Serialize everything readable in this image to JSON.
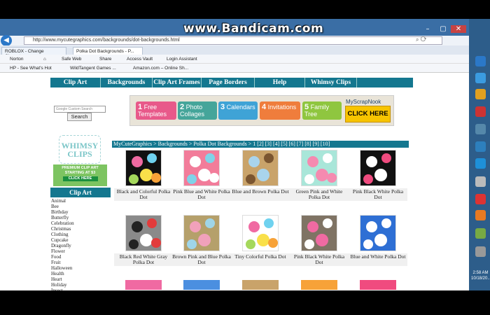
{
  "recorder": {
    "watermark": "www.Bandicam.com",
    "hp": "hp"
  },
  "browser": {
    "url": "http://www.mycutegraphics.com/backgrounds/dot-backgrounds.html",
    "tabs": [
      "ROBLOX - Change Character",
      "Polka Dot Backgrounds - P..."
    ],
    "toolbar1": [
      "Norton",
      "Safe Web",
      "Share",
      "Access Vault",
      "Login Assistant"
    ],
    "toolbar2": [
      "HP - See What's Hot",
      "WildTangent Games ...",
      "Amazon.com – Online Sh..."
    ]
  },
  "site": {
    "nav": [
      "Clip Art",
      "Backgrounds",
      "Clip Art Frames",
      "Page Borders",
      "Help",
      "Whimsy Clips"
    ],
    "search_placeholder": "Google Custom Search",
    "search_button": "Search",
    "banner": {
      "items": [
        {
          "num": "1",
          "text": "Free Templates",
          "color": "#e8598a"
        },
        {
          "num": "2",
          "text": "Photo Collages",
          "color": "#45a59a"
        },
        {
          "num": "3",
          "text": "Calendars",
          "color": "#3fa3d6"
        },
        {
          "num": "4",
          "text": "Invitations",
          "color": "#ef7d3c"
        },
        {
          "num": "5",
          "text": "Family Tree",
          "color": "#8fc63f"
        }
      ],
      "ad_title": "MyScrapNook",
      "ad_button": "CLICK HERE"
    },
    "whimsy": {
      "logo": "WHIMSY CLIPS",
      "premium": "PREMIUM CLIP ART STARTING AT $3",
      "premium_button": "CLICK HERE"
    },
    "sidebar": {
      "heading": "Clip Art",
      "links": [
        "Animal",
        "Bee",
        "Birthday",
        "Butterfly",
        "Celebration",
        "Christmas",
        "Clothing",
        "Cupcake",
        "Dragonfly",
        "Flower",
        "Food",
        "Fruit",
        "Halloween",
        "Health",
        "Heart",
        "Holiday",
        "Insect"
      ]
    },
    "breadcrumb": "MyCuteGraphics > Backgrounds > Polka Dot Backgrounds > 1 [2] [3] [4] [5] [6] [7] [8] [9] [10]",
    "thumbnails": [
      {
        "caption": "Black and Colorful Polka Dot",
        "bg": "#111111",
        "dots": [
          "#f06aa2",
          "#6fd2ef",
          "#f9e04a",
          "#a5d85c",
          "#f7a238"
        ]
      },
      {
        "caption": "Pink Blue and White Polka Dot",
        "bg": "#f27c9a",
        "dots": [
          "#ffffff",
          "#7fd3e8",
          "#ffffff",
          "#7fd3e8",
          "#ffffff"
        ]
      },
      {
        "caption": "Blue and Brown Polka Dot",
        "bg": "#c9a36a",
        "dots": [
          "#a9d4ec",
          "#7a5530",
          "#a9d4ec",
          "#7a5530"
        ]
      },
      {
        "caption": "Green Pink and White Polka Dot",
        "bg": "#a9e6d9",
        "dots": [
          "#f58ab0",
          "#ffffff",
          "#f58ab0",
          "#ffffff",
          "#f58ab0"
        ]
      },
      {
        "caption": "Pink Black White Polka Dot",
        "bg": "#111111",
        "dots": [
          "#ffffff",
          "#f04b7f",
          "#ffffff",
          "#f04b7f"
        ]
      },
      {
        "caption": "Black Red White Gray Polka Dot",
        "bg": "#8a8a8a",
        "dots": [
          "#222222",
          "#e23b3b",
          "#ffffff",
          "#222222",
          "#e23b3b"
        ]
      },
      {
        "caption": "Brown Pink and Blue Polka Dot",
        "bg": "#b5a06b",
        "dots": [
          "#f1a1ba",
          "#9fd5e8",
          "#f1a1ba",
          "#9fd5e8"
        ]
      },
      {
        "caption": "Tiny Colorful Polka Dot",
        "bg": "#ffffff",
        "dots": [
          "#f06aa2",
          "#6fd2ef",
          "#f9e04a",
          "#a5d85c",
          "#f7a238"
        ]
      },
      {
        "caption": "Pink Black White Polka Dot",
        "bg": "#7f7364",
        "dots": [
          "#f06aa2",
          "#ffffff",
          "#f06aa2",
          "#ffffff"
        ]
      },
      {
        "caption": "Blue and White Polka Dot",
        "bg": "#2e6fd4",
        "dots": [
          "#ffffff",
          "#ffffff",
          "#ffffff",
          "#ffffff"
        ]
      }
    ],
    "row3_colors": [
      "#f06aa2",
      "#4b8fe0",
      "#c9a36a",
      "#f7a238",
      "#f04b7f"
    ]
  },
  "taskbar": {
    "time": "2:58 AM",
    "date": "10/18/20..."
  }
}
